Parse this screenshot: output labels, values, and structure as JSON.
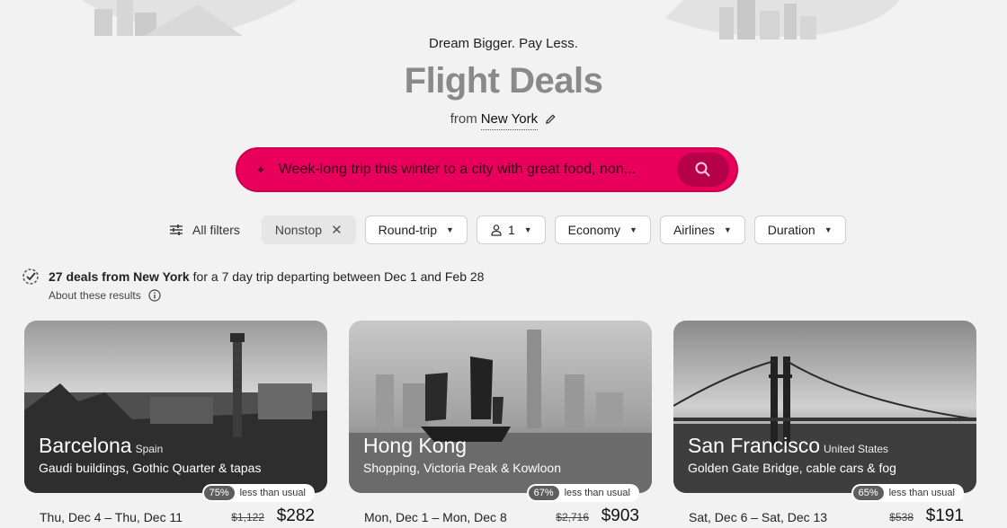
{
  "header": {
    "tagline": "Dream Bigger. Pay Less.",
    "title": "Flight Deals",
    "origin_prefix": "from",
    "origin_city": "New York"
  },
  "search": {
    "value": "Week-long trip this winter to a city with great food, non...",
    "placeholder": "Week-long trip this winter to a city with great food, non..."
  },
  "filters": {
    "all_filters": "All filters",
    "nonstop": "Nonstop",
    "trip_type": "Round-trip",
    "passengers": "1",
    "cabin": "Economy",
    "airlines": "Airlines",
    "duration": "Duration"
  },
  "results": {
    "count_text": "27 deals from New York",
    "rest_text": "for a 7 day trip departing between Dec 1 and Feb 28",
    "about": "About these results"
  },
  "deals": [
    {
      "city": "Barcelona",
      "country": "Spain",
      "description": "Gaudi buildings, Gothic Quarter & tapas",
      "discount": "75%",
      "discount_label": "less than usual",
      "dates": "Thu, Dec 4 – Thu, Dec 11",
      "old_price": "$1,122",
      "price": "$282"
    },
    {
      "city": "Hong Kong",
      "country": "",
      "description": "Shopping, Victoria Peak & Kowloon",
      "discount": "67%",
      "discount_label": "less than usual",
      "dates": "Mon, Dec 1 – Mon, Dec 8",
      "old_price": "$2,716",
      "price": "$903"
    },
    {
      "city": "San Francisco",
      "country": "United States",
      "description": "Golden Gate Bridge, cable cars & fog",
      "discount": "65%",
      "discount_label": "less than usual",
      "dates": "Sat, Dec 6 – Sat, Dec 13",
      "old_price": "$538",
      "price": "$191"
    }
  ],
  "colors": {
    "search_bar": "#e8005c",
    "search_button": "#b7004a",
    "title": "#8a8a8a"
  },
  "icons": [
    "sparkle-icon",
    "search-icon",
    "pencil-icon",
    "sliders-icon",
    "close-icon",
    "person-icon",
    "caret-down-icon",
    "check-badge-icon",
    "info-icon"
  ]
}
